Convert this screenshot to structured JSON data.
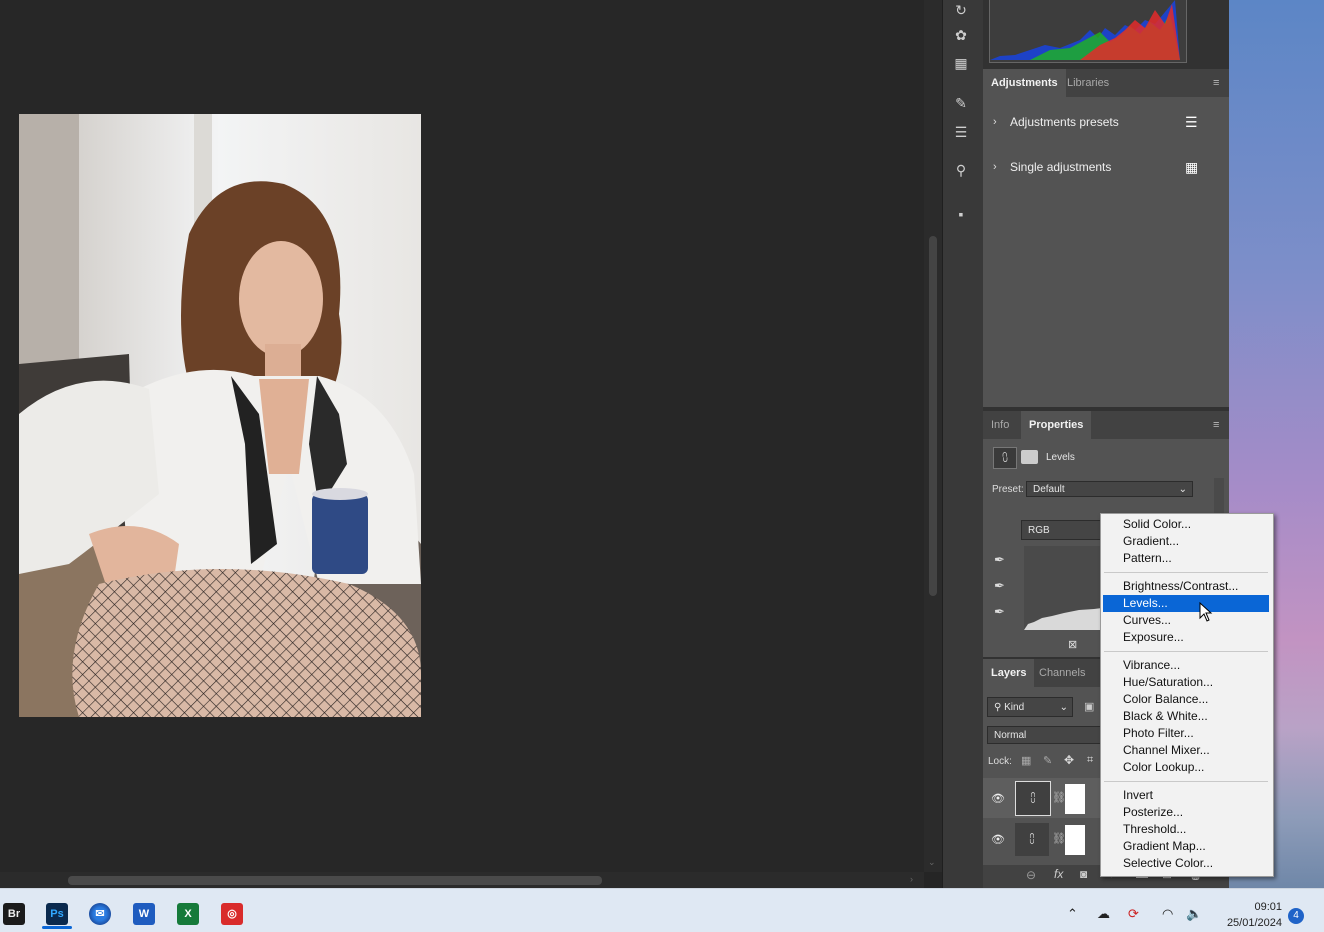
{
  "colors": {
    "menu_highlight": "#0a66d6",
    "panel_bg": "#535353",
    "app_bg": "#252525"
  },
  "panels": {
    "adjustments": {
      "tabs": [
        "Adjustments",
        "Libraries"
      ],
      "rows": [
        "Adjustments presets",
        "Single adjustments"
      ]
    },
    "properties": {
      "tabs": [
        "Info",
        "Properties"
      ],
      "layer_type": "Levels",
      "preset_label": "Preset:",
      "preset_value": "Default",
      "channel": "RGB"
    },
    "layers": {
      "tabs": [
        "Layers",
        "Channels"
      ],
      "filter": "Kind",
      "blend_mode": "Normal",
      "lock_label": "Lock:"
    }
  },
  "context_menu": {
    "groups": [
      [
        "Solid Color...",
        "Gradient...",
        "Pattern..."
      ],
      [
        "Brightness/Contrast...",
        "Levels...",
        "Curves...",
        "Exposure..."
      ],
      [
        "Vibrance...",
        "Hue/Saturation...",
        "Color Balance...",
        "Black & White...",
        "Photo Filter...",
        "Channel Mixer...",
        "Color Lookup..."
      ],
      [
        "Invert",
        "Posterize...",
        "Threshold...",
        "Gradient Map...",
        "Selective Color..."
      ]
    ],
    "highlighted": "Levels..."
  },
  "taskbar": {
    "apps": [
      "Br",
      "Ps",
      "Thunderbird",
      "Word",
      "Excel",
      "Recorder"
    ],
    "time": "09:01",
    "date": "25/01/2024",
    "notifications": "4"
  }
}
